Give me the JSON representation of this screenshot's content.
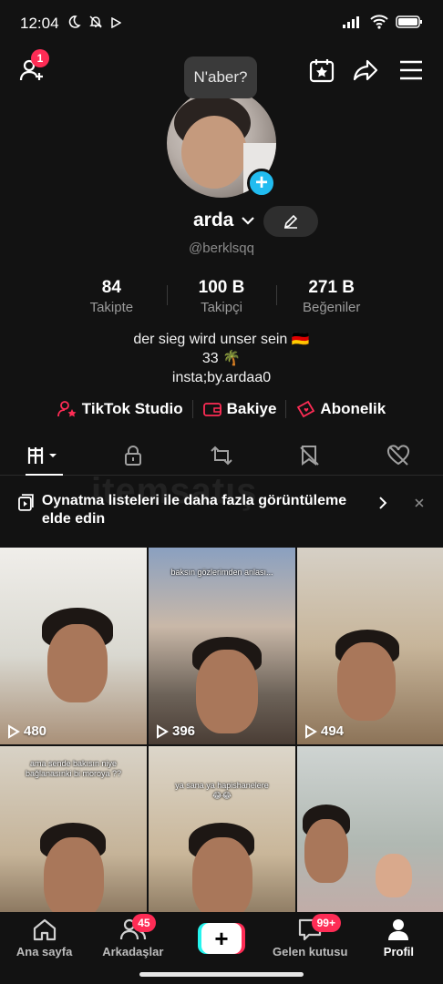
{
  "status": {
    "time": "12:04",
    "battery_color": "#ffffff"
  },
  "header": {
    "add_friends_badge": "1",
    "bubble_text": "N'aber?"
  },
  "profile": {
    "username": "arda",
    "handle": "@berklsqq",
    "stats": [
      {
        "value": "84",
        "label": "Takipte"
      },
      {
        "value": "100 B",
        "label": "Takipçi"
      },
      {
        "value": "271 B",
        "label": "Beğeniler"
      }
    ],
    "bio": [
      "der sieg wird  unser sein 🇩🇪",
      "33 🌴",
      "insta;by.ardaa0"
    ]
  },
  "links": [
    {
      "label": "TikTok Studio",
      "icon": "person-star-icon"
    },
    {
      "label": "Bakiye",
      "icon": "wallet-icon"
    },
    {
      "label": "Abonelik",
      "icon": "heart-ticket-icon"
    }
  ],
  "tabs": [
    "videos-tab",
    "private-tab",
    "reposts-tab",
    "favorites-tab",
    "liked-tab"
  ],
  "banner": {
    "text": "Oynatma listeleri ile daha fazla görüntüleme elde edin"
  },
  "watermark": "itemsatış",
  "videos": [
    {
      "views": "480",
      "caption": ""
    },
    {
      "views": "396",
      "caption": "baksın gözlerimden anlası..."
    },
    {
      "views": "494",
      "caption": ""
    },
    {
      "views": "",
      "caption": "ama sende bakısın niye bağlanasınki bi moroya ??"
    },
    {
      "views": "",
      "caption": "ya sana ya hapishanelere 😂😂"
    },
    {
      "views": "",
      "caption": ""
    }
  ],
  "nav": [
    {
      "label": "Ana sayfa",
      "badge": ""
    },
    {
      "label": "Arkadaşlar",
      "badge": "45"
    },
    {
      "label": "",
      "badge": ""
    },
    {
      "label": "Gelen kutusu",
      "badge": "99+"
    },
    {
      "label": "Profil",
      "badge": ""
    }
  ],
  "colors": {
    "accent": "#fe2c55",
    "cyan": "#25f4ee",
    "add_blue": "#21bcf0"
  }
}
